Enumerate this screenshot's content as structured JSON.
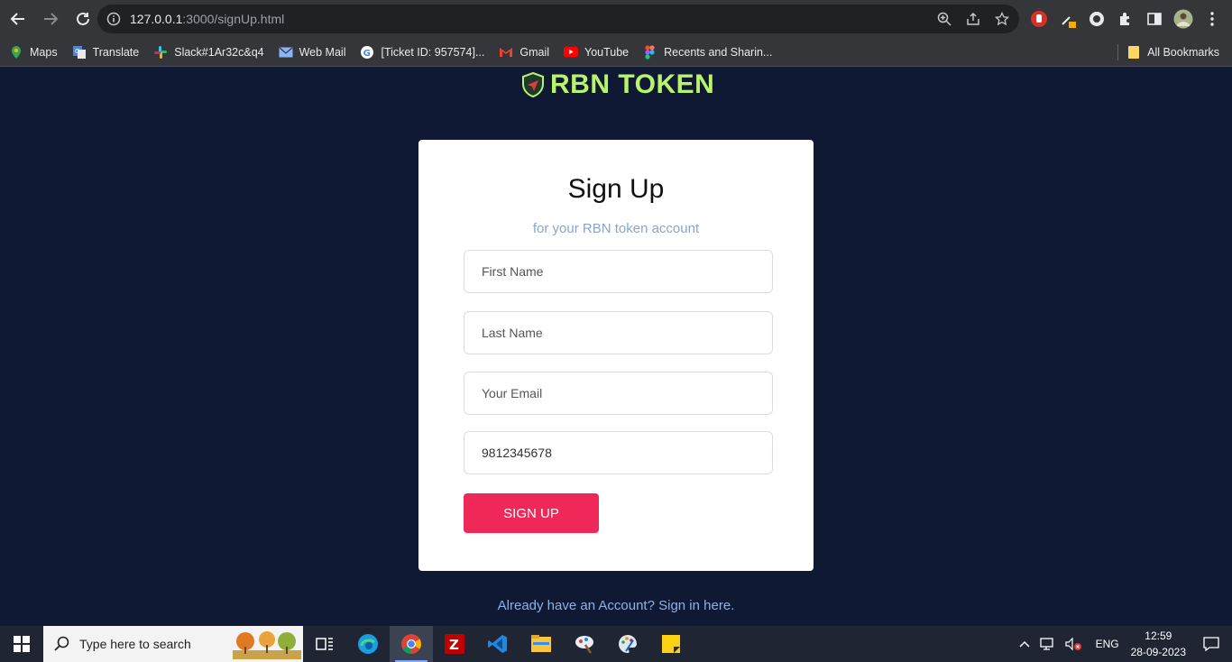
{
  "browser": {
    "url_host": "127.0.0.1",
    "url_path": ":3000/signUp.html",
    "bookmarks": [
      {
        "label": "Maps",
        "icon": "maps-icon"
      },
      {
        "label": "Translate",
        "icon": "translate-icon"
      },
      {
        "label": "Slack#1Ar32c&q4",
        "icon": "slack-icon"
      },
      {
        "label": "Web Mail",
        "icon": "mail-icon"
      },
      {
        "label": "[Ticket ID: 957574]...",
        "icon": "google-icon"
      },
      {
        "label": "Gmail",
        "icon": "gmail-icon"
      },
      {
        "label": "YouTube",
        "icon": "youtube-icon"
      },
      {
        "label": "Recents and Sharin...",
        "icon": "figma-icon"
      }
    ],
    "all_bookmarks": "All Bookmarks"
  },
  "page": {
    "logo_text": "RBN TOKEN",
    "title": "Sign Up",
    "subtitle": "for your RBN token account",
    "fields": {
      "first_name_placeholder": "First Name",
      "last_name_placeholder": "Last Name",
      "email_placeholder": "Your Email",
      "phone_value": "9812345678"
    },
    "signup_label": "SIGN UP",
    "signin_text": "Already have an Account? Sign in here."
  },
  "taskbar": {
    "search_placeholder": "Type here to search",
    "language": "ENG",
    "time": "12:59",
    "date": "28-09-2023"
  },
  "colors": {
    "page_bg": "#0f1933",
    "logo": "#b7f36b",
    "button": "#f0285a",
    "subtitle": "#8aa6c7",
    "link": "#8fb0e6"
  }
}
